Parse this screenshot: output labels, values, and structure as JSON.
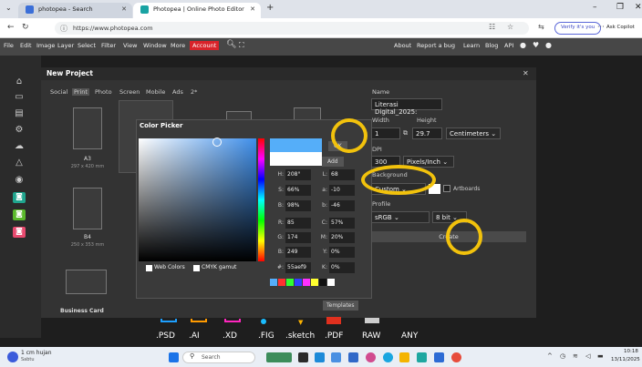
{
  "browser": {
    "tabs": [
      {
        "label": "photopea - Search"
      },
      {
        "label": "Photopea | Online Photo Editor"
      }
    ],
    "url": "https://www.photopea.com",
    "verify_label": "Verify it's you",
    "copilot_label": "Ask Copilot"
  },
  "menu": {
    "items": [
      "File",
      "Edit",
      "Image",
      "Layer",
      "Select",
      "Filter",
      "View",
      "Window",
      "More"
    ],
    "account": "Account",
    "right_items": [
      "About",
      "Report a bug",
      "Learn",
      "Blog",
      "API"
    ]
  },
  "new_project": {
    "title": "New Project",
    "tabs": [
      "Social",
      "Print",
      "Photo",
      "Screen",
      "Mobile",
      "Ads",
      "2*"
    ],
    "presets": [
      {
        "name": "A3",
        "size": "297 x 420 mm"
      },
      {
        "name": "B4",
        "size": "250 x 353 mm"
      },
      {
        "name": "Business Card",
        "size": ""
      }
    ],
    "name_label": "Name",
    "name_value": "Literasi Digital_2025:",
    "width_label": "Width",
    "height_label": "Height",
    "width_value": "1",
    "height_value": "29.7",
    "units": "Centimeters",
    "dpi_label": "DPI",
    "dpi_value": "300",
    "dpi_unit": "Pixels/Inch",
    "background_label": "Background",
    "background_value": "Custom",
    "artboards_label": "Artboards",
    "profile_label": "Profile",
    "profile_value": "sRGB",
    "bits_value": "8 bit",
    "create_label": "Create",
    "templates_label": "Templates"
  },
  "color_picker": {
    "title": "Color Picker",
    "ok_label": "OK",
    "add_label": "Add",
    "rows": [
      {
        "l1": "H:",
        "v1": "208°",
        "l2": "L:",
        "v2": "68"
      },
      {
        "l1": "S:",
        "v1": "66%",
        "l2": "a:",
        "v2": "-10"
      },
      {
        "l1": "B:",
        "v1": "98%",
        "l2": "b:",
        "v2": "-46"
      },
      {
        "l1": "R:",
        "v1": "85",
        "l2": "C:",
        "v2": "57%"
      },
      {
        "l1": "G:",
        "v1": "174",
        "l2": "M:",
        "v2": "20%"
      },
      {
        "l1": "B:",
        "v1": "249",
        "l2": "Y:",
        "v2": "0%"
      },
      {
        "l1": "#:",
        "v1": "55aef9",
        "l2": "K:",
        "v2": "0%"
      }
    ],
    "web_colors_label": "Web Colors",
    "cmyk_label": "CMYK gamut",
    "current_color": "#55aef9"
  },
  "formats": [
    ".PSD",
    ".AI",
    ".XD",
    ".FIG",
    ".sketch",
    ".PDF",
    "RAW",
    "ANY"
  ],
  "taskbar": {
    "weather_temp": "1 cm hujan",
    "weather_day": "Sabtu",
    "search_label": "Search",
    "time": "10:18",
    "date": "13/11/2025"
  }
}
